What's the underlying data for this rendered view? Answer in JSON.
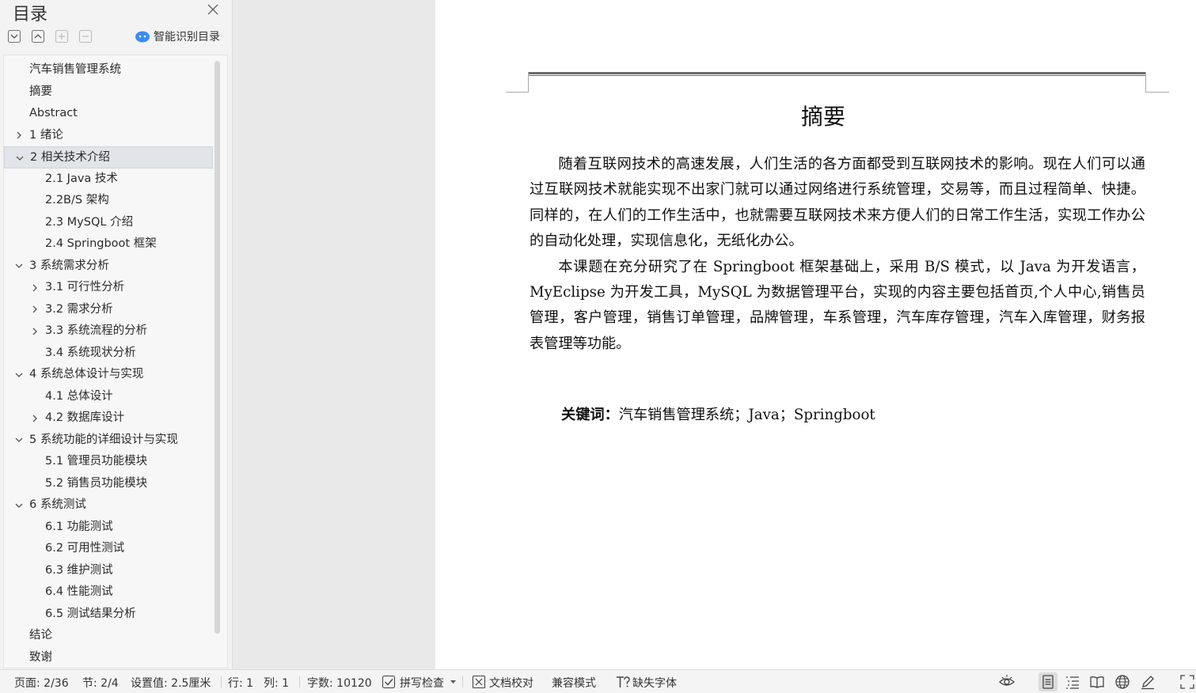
{
  "toc": {
    "title": "目录",
    "smart_label": "智能识别目录",
    "items": [
      {
        "label": "汽车销售管理系统",
        "level": 1,
        "expander": "none"
      },
      {
        "label": "摘要",
        "level": 1,
        "expander": "none"
      },
      {
        "label": "Abstract",
        "level": 1,
        "expander": "none"
      },
      {
        "label": "1  绪论",
        "level": 1,
        "expander": "collapsed"
      },
      {
        "label": "2 相关技术介绍",
        "level": 1,
        "expander": "expanded",
        "active": true
      },
      {
        "label": "2.1 Java 技术",
        "level": 2,
        "expander": "none"
      },
      {
        "label": "2.2B/S 架构",
        "level": 2,
        "expander": "none"
      },
      {
        "label": "2.3 MySQL 介绍",
        "level": 2,
        "expander": "none"
      },
      {
        "label": "2.4 Springboot 框架",
        "level": 2,
        "expander": "none"
      },
      {
        "label": "3 系统需求分析",
        "level": 1,
        "expander": "expanded"
      },
      {
        "label": "3.1  可行性分析",
        "level": 2,
        "expander": "collapsed"
      },
      {
        "label": "3.2  需求分析",
        "level": 2,
        "expander": "collapsed"
      },
      {
        "label": "3.3 系统流程的分析",
        "level": 2,
        "expander": "collapsed"
      },
      {
        "label": "3.4  系统现状分析",
        "level": 2,
        "expander": "none"
      },
      {
        "label": "4 系统总体设计与实现",
        "level": 1,
        "expander": "expanded"
      },
      {
        "label": "4.1  总体设计",
        "level": 2,
        "expander": "none"
      },
      {
        "label": "4.2  数据库设计",
        "level": 2,
        "expander": "collapsed"
      },
      {
        "label": "5  系统功能的详细设计与实现",
        "level": 1,
        "expander": "expanded"
      },
      {
        "label": "5.1  管理员功能模块",
        "level": 2,
        "expander": "none"
      },
      {
        "label": "5.2  销售员功能模块",
        "level": 2,
        "expander": "none"
      },
      {
        "label": "6  系统测试",
        "level": 1,
        "expander": "expanded"
      },
      {
        "label": "6.1  功能测试",
        "level": 2,
        "expander": "none"
      },
      {
        "label": "6.2  可用性测试",
        "level": 2,
        "expander": "none"
      },
      {
        "label": "6.3  维护测试",
        "level": 2,
        "expander": "none"
      },
      {
        "label": "6.4  性能测试",
        "level": 2,
        "expander": "none"
      },
      {
        "label": "6.5  测试结果分析",
        "level": 2,
        "expander": "none"
      },
      {
        "label": "结论",
        "level": 1,
        "expander": "none"
      },
      {
        "label": "致谢",
        "level": 1,
        "expander": "none"
      }
    ]
  },
  "document": {
    "heading": "摘要",
    "paragraphs": [
      "随着互联网技术的高速发展，人们生活的各方面都受到互联网技术的影响。现在人们可以通过互联网技术就能实现不出家门就可以通过网络进行系统管理，交易等，而且过程简单、快捷。同样的，在人们的工作生活中，也就需要互联网技术来方便人们的日常工作生活，实现工作办公的自动化处理，实现信息化，无纸化办公。",
      "本课题在充分研究了在 Springboot 框架基础上，采用 B/S 模式，以 Java 为开发语言，MyEclipse 为开发工具，MySQL 为数据管理平台，实现的内容主要包括首页,个人中心,销售员管理，客户管理，销售订单管理，品牌管理，车系管理，汽车库存管理，汽车入库管理，财务报表管理等功能。"
    ],
    "keywords_label": "关键词：",
    "keywords_value": "汽车销售管理系统；Java；Springboot"
  },
  "status": {
    "page": "页面: 2/36",
    "section": "节: 2/4",
    "setting": "设置值: 2.5厘米",
    "row": "行: 1",
    "col": "列: 1",
    "wordcount": "字数: 10120",
    "spellcheck": "拼写检查",
    "proofread": "文档校对",
    "compat": "兼容模式",
    "missing_font": "缺失字体"
  }
}
